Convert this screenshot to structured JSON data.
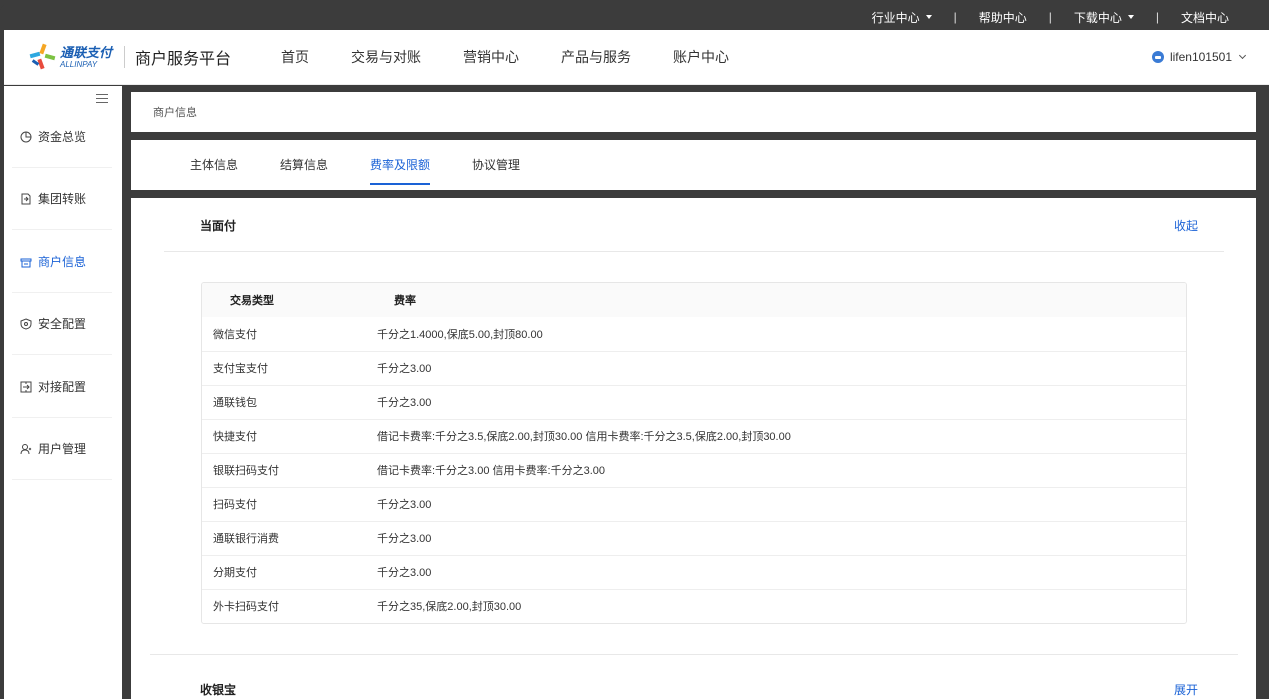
{
  "utility_bar": {
    "items": [
      {
        "label": "行业中心",
        "dropdown": true
      },
      {
        "label": "帮助中心",
        "dropdown": false
      },
      {
        "label": "下载中心",
        "dropdown": true
      },
      {
        "label": "文档中心",
        "dropdown": false
      }
    ],
    "separator": "|"
  },
  "header": {
    "logo_cn": "通联支付",
    "logo_en": "ALLINPAY",
    "platform_title": "商户服务平台",
    "nav": [
      "首页",
      "交易与对账",
      "营销中心",
      "产品与服务",
      "账户中心"
    ],
    "username": "lifen101501"
  },
  "sidebar": {
    "items": [
      {
        "label": "资金总览",
        "icon": "pie-chart-icon",
        "active": false
      },
      {
        "label": "集团转账",
        "icon": "transfer-doc-icon",
        "active": false
      },
      {
        "label": "商户信息",
        "icon": "store-icon",
        "active": true
      },
      {
        "label": "安全配置",
        "icon": "shield-icon",
        "active": false
      },
      {
        "label": "对接配置",
        "icon": "connect-icon",
        "active": false
      },
      {
        "label": "用户管理",
        "icon": "user-icon",
        "active": false
      }
    ]
  },
  "breadcrumb": "商户信息",
  "tabs": [
    {
      "label": "主体信息",
      "active": false
    },
    {
      "label": "结算信息",
      "active": false
    },
    {
      "label": "费率及限额",
      "active": true
    },
    {
      "label": "协议管理",
      "active": false
    }
  ],
  "sections": [
    {
      "title": "当面付",
      "toggle": "收起"
    },
    {
      "title": "收银宝",
      "toggle": "展开"
    }
  ],
  "rate_table": {
    "headers": [
      "交易类型",
      "费率"
    ],
    "rows": [
      [
        "微信支付",
        "千分之1.4000,保底5.00,封顶80.00"
      ],
      [
        "支付宝支付",
        "千分之3.00"
      ],
      [
        "通联钱包",
        "千分之3.00"
      ],
      [
        "快捷支付",
        "借记卡费率:千分之3.5,保底2.00,封顶30.00 信用卡费率:千分之3.5,保底2.00,封顶30.00"
      ],
      [
        "银联扫码支付",
        "借记卡费率:千分之3.00 信用卡费率:千分之3.00"
      ],
      [
        "扫码支付",
        "千分之3.00"
      ],
      [
        "通联银行消费",
        "千分之3.00"
      ],
      [
        "分期支付",
        "千分之3.00"
      ],
      [
        "外卡扫码支付",
        "千分之35,保底2.00,封顶30.00"
      ]
    ]
  },
  "colors": {
    "accent": "#1a62d6",
    "topbar": "#3c3c3c",
    "page_bg": "#f0f2f5"
  }
}
